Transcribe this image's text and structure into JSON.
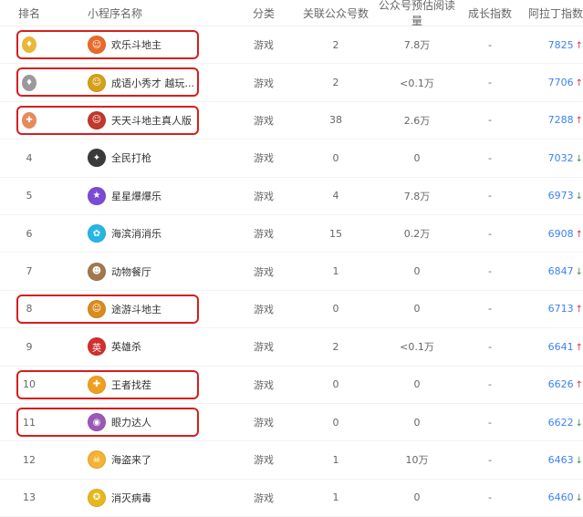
{
  "columns": {
    "rank": "排名",
    "name": "小程序名称",
    "category": "分类",
    "related": "关联公众号数",
    "reads": "公众号预估阅读量",
    "growth": "成长指数",
    "index": "阿拉丁指数"
  },
  "rows": [
    {
      "rank": "1",
      "name": "欢乐斗地主",
      "category": "游戏",
      "related": "2",
      "reads": "7.8万",
      "growth": "-",
      "index": "7825",
      "trend": "up",
      "highlight": true,
      "medal": "gold",
      "avatar_color": "#e96a2a",
      "avatar_icon": "☺"
    },
    {
      "rank": "2",
      "name": "成语小秀才 越玩...",
      "category": "游戏",
      "related": "2",
      "reads": "<0.1万",
      "growth": "-",
      "index": "7706",
      "trend": "up",
      "highlight": true,
      "medal": "silver",
      "avatar_color": "#d4a017",
      "avatar_icon": "☺"
    },
    {
      "rank": "3",
      "name": "天天斗地主真人版",
      "category": "游戏",
      "related": "38",
      "reads": "2.6万",
      "growth": "-",
      "index": "7288",
      "trend": "up",
      "highlight": true,
      "medal": "bronze",
      "avatar_color": "#c0392b",
      "avatar_icon": "☺"
    },
    {
      "rank": "4",
      "name": "全民打枪",
      "category": "游戏",
      "related": "0",
      "reads": "0",
      "growth": "-",
      "index": "7032",
      "trend": "down",
      "highlight": false,
      "medal": "",
      "avatar_color": "#3a3a3a",
      "avatar_icon": "✦"
    },
    {
      "rank": "5",
      "name": "星星爆爆乐",
      "category": "游戏",
      "related": "4",
      "reads": "7.8万",
      "growth": "-",
      "index": "6973",
      "trend": "down",
      "highlight": false,
      "medal": "",
      "avatar_color": "#7b4bd6",
      "avatar_icon": "★"
    },
    {
      "rank": "6",
      "name": "海滨消消乐",
      "category": "游戏",
      "related": "15",
      "reads": "0.2万",
      "growth": "-",
      "index": "6908",
      "trend": "up",
      "highlight": false,
      "medal": "",
      "avatar_color": "#27b5e6",
      "avatar_icon": "✿"
    },
    {
      "rank": "7",
      "name": "动物餐厅",
      "category": "游戏",
      "related": "1",
      "reads": "0",
      "growth": "-",
      "index": "6847",
      "trend": "down",
      "highlight": false,
      "medal": "",
      "avatar_color": "#a07850",
      "avatar_icon": "☻"
    },
    {
      "rank": "8",
      "name": "途游斗地主",
      "category": "游戏",
      "related": "0",
      "reads": "0",
      "growth": "-",
      "index": "6713",
      "trend": "up",
      "highlight": true,
      "medal": "",
      "avatar_color": "#d98b1e",
      "avatar_icon": "☺"
    },
    {
      "rank": "9",
      "name": "英雄杀",
      "category": "游戏",
      "related": "2",
      "reads": "<0.1万",
      "growth": "-",
      "index": "6641",
      "trend": "up",
      "highlight": false,
      "medal": "",
      "avatar_color": "#d12f2f",
      "avatar_icon": "英"
    },
    {
      "rank": "10",
      "name": "王者找茬",
      "category": "游戏",
      "related": "0",
      "reads": "0",
      "growth": "-",
      "index": "6626",
      "trend": "up",
      "highlight": true,
      "medal": "",
      "avatar_color": "#f0a020",
      "avatar_icon": "✚"
    },
    {
      "rank": "11",
      "name": "眼力达人",
      "category": "游戏",
      "related": "0",
      "reads": "0",
      "growth": "-",
      "index": "6622",
      "trend": "down",
      "highlight": true,
      "medal": "",
      "avatar_color": "#9b59b6",
      "avatar_icon": "◉"
    },
    {
      "rank": "12",
      "name": "海盗来了",
      "category": "游戏",
      "related": "1",
      "reads": "10万",
      "growth": "-",
      "index": "6463",
      "trend": "down",
      "highlight": false,
      "medal": "",
      "avatar_color": "#f2b233",
      "avatar_icon": "☠"
    },
    {
      "rank": "13",
      "name": "消灭病毒",
      "category": "游戏",
      "related": "1",
      "reads": "0",
      "growth": "-",
      "index": "6460",
      "trend": "down",
      "highlight": false,
      "medal": "",
      "avatar_color": "#e8b71c",
      "avatar_icon": "✪"
    }
  ],
  "colors": {
    "gold": "#e9b83a",
    "silver": "#9a9a9a",
    "bronze": "#e58b59",
    "highlight": "#d61e1e",
    "index_blue": "#3b82f6"
  },
  "icons": {
    "up": "↑",
    "down": "↓",
    "medal_gold": "♦",
    "medal_silver": "♦",
    "medal_bronze": "✚"
  }
}
